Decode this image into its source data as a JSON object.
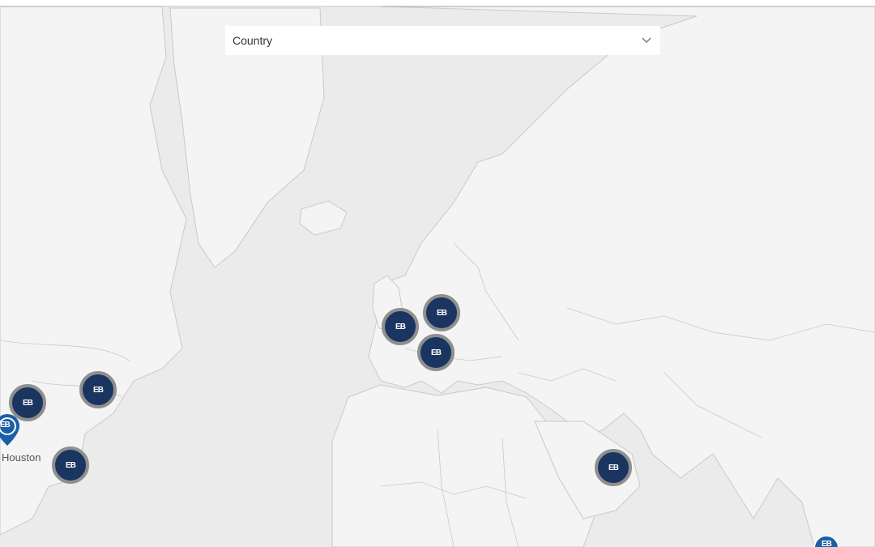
{
  "filter": {
    "placeholder": "Country",
    "chevron_icon": "chevron-down-icon"
  },
  "map": {
    "land_color": "#f4f4f4",
    "sea_color": "#ebebeb",
    "border_color": "#c9c9c9",
    "marker_fill": "#1b3561",
    "marker_ring": "#8f8f8f",
    "marker_logo": "EB"
  },
  "markers": [
    {
      "id": "marker-north-america-1",
      "logo": "EB"
    },
    {
      "id": "marker-north-america-2",
      "logo": "EB"
    },
    {
      "id": "marker-houston",
      "logo": "EB",
      "label": "Houston"
    },
    {
      "id": "marker-caribbean",
      "logo": "EB"
    },
    {
      "id": "marker-uk",
      "logo": "EB"
    },
    {
      "id": "marker-northern-europe",
      "logo": "EB"
    },
    {
      "id": "marker-central-europe",
      "logo": "EB"
    },
    {
      "id": "marker-middle-east",
      "logo": "EB"
    },
    {
      "id": "marker-asia-edge",
      "logo": "EB"
    }
  ]
}
